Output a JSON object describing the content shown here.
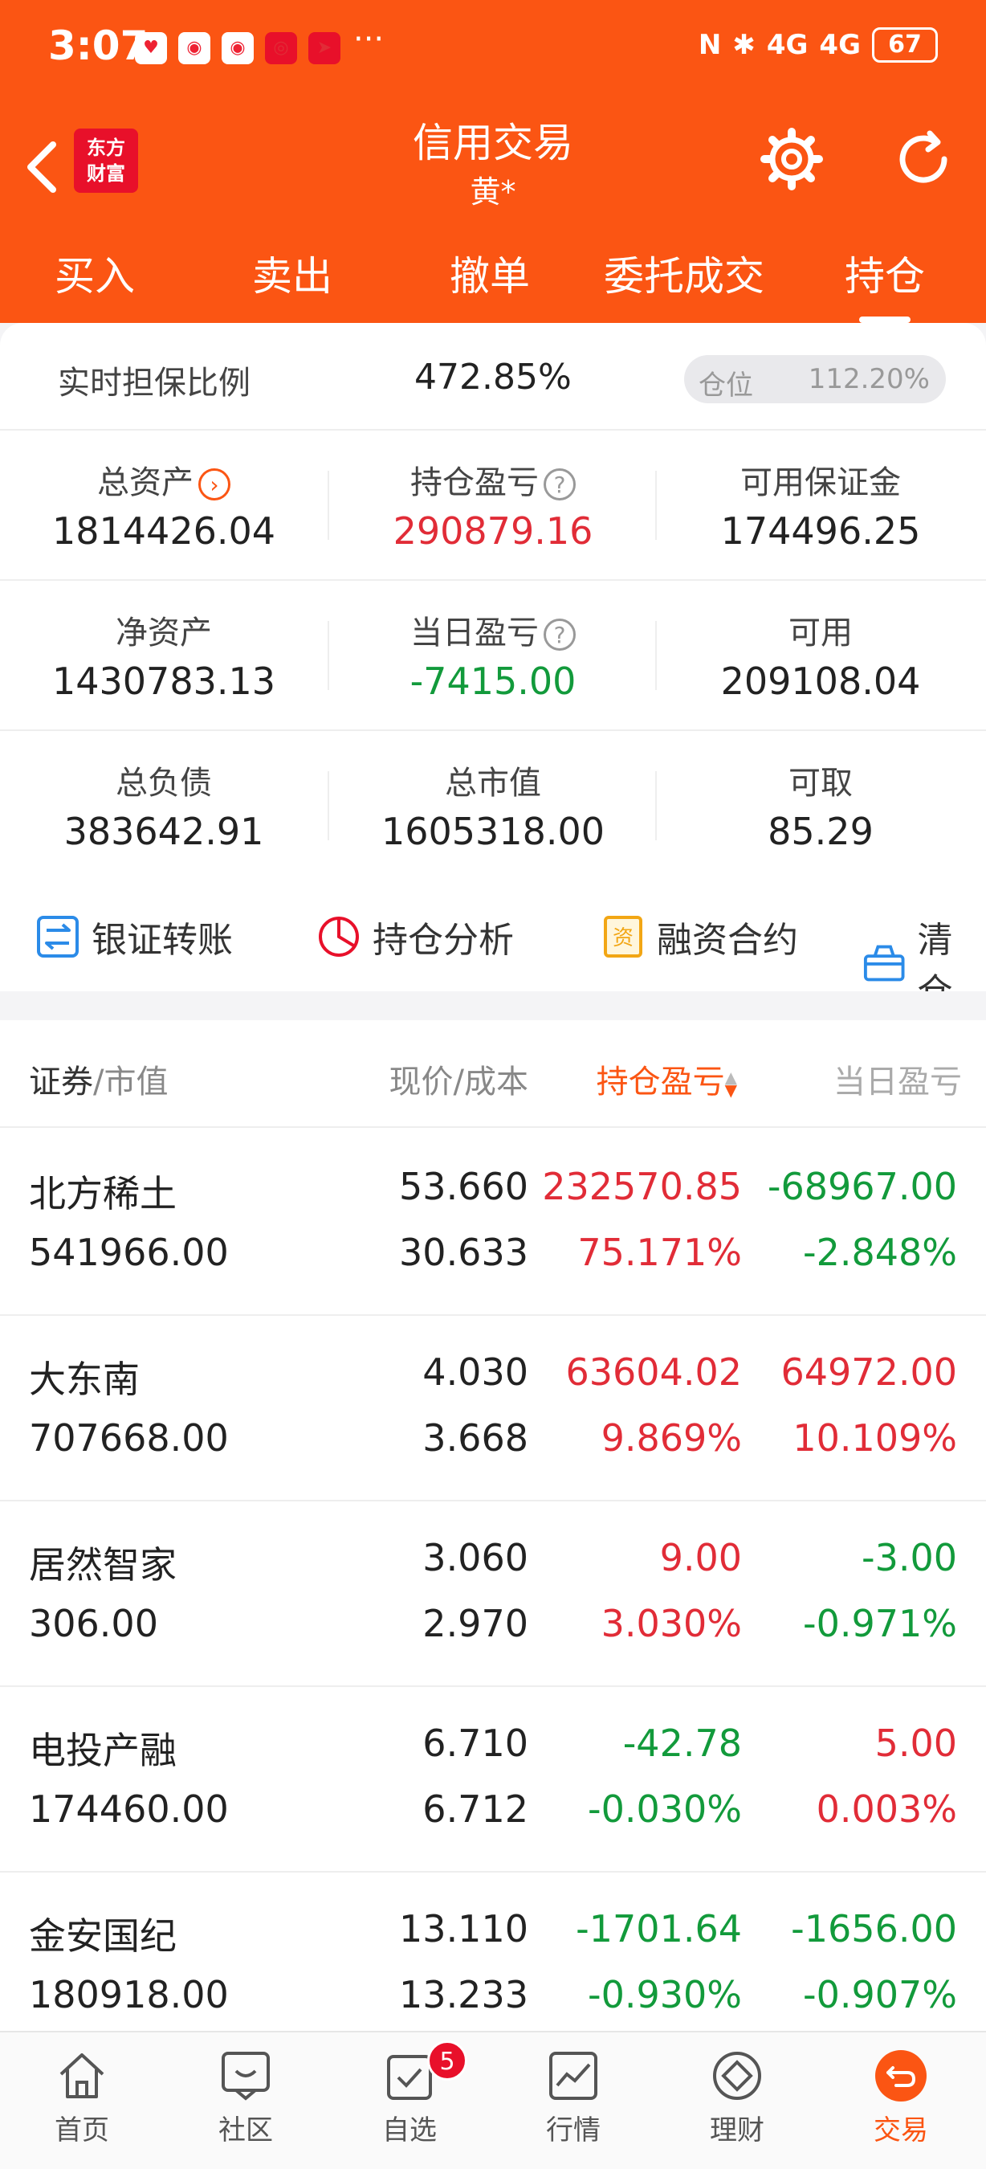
{
  "status": {
    "time": "3:07",
    "battery": "67",
    "more": "···",
    "signal_1": "4G",
    "signal_2": "4G"
  },
  "header": {
    "logo_line1": "东方",
    "logo_line2": "财富",
    "title": "信用交易",
    "subtitle": "黄*"
  },
  "tabs": [
    "买入",
    "卖出",
    "撤单",
    "委托成交",
    "持仓"
  ],
  "summary": {
    "ratio_label": "实时担保比例",
    "ratio_value": "472.85%",
    "position_label": "仓位",
    "position_value": "112.20%",
    "rows": [
      [
        {
          "label": "总资产",
          "value": "1814426.04"
        },
        {
          "label": "持仓盈亏",
          "value": "290879.16"
        },
        {
          "label": "可用保证金",
          "value": "174496.25"
        }
      ],
      [
        {
          "label": "净资产",
          "value": "1430783.13"
        },
        {
          "label": "当日盈亏",
          "value": "-7415.00"
        },
        {
          "label": "可用",
          "value": "209108.04"
        }
      ],
      [
        {
          "label": "总负债",
          "value": "383642.91"
        },
        {
          "label": "总市值",
          "value": "1605318.00"
        },
        {
          "label": "可取",
          "value": "85.29"
        }
      ]
    ]
  },
  "quick": [
    "银证转账",
    "持仓分析",
    "融资合约",
    "清仓"
  ],
  "holdings_header": {
    "col1": "证券",
    "col1_sub": "/市值",
    "col2": "现价/成本",
    "col3": "持仓盈亏",
    "col4": "当日盈亏"
  },
  "holdings": [
    {
      "name": "北方稀土",
      "mv": "541966.00",
      "price": "53.660",
      "cost": "30.633",
      "pl": "232570.85",
      "plp": "75.171%",
      "dp": "-68967.00",
      "dpp": "-2.848%"
    },
    {
      "name": "大东南",
      "mv": "707668.00",
      "price": "4.030",
      "cost": "3.668",
      "pl": "63604.02",
      "plp": "9.869%",
      "dp": "64972.00",
      "dpp": "10.109%"
    },
    {
      "name": "居然智家",
      "mv": "306.00",
      "price": "3.060",
      "cost": "2.970",
      "pl": "9.00",
      "plp": "3.030%",
      "dp": "-3.00",
      "dpp": "-0.971%"
    },
    {
      "name": "电投产融",
      "mv": "174460.00",
      "price": "6.710",
      "cost": "6.712",
      "pl": "-42.78",
      "plp": "-0.030%",
      "dp": "5.00",
      "dpp": "0.003%"
    },
    {
      "name": "金安国纪",
      "mv": "180918.00",
      "price": "13.110",
      "cost": "13.233",
      "pl": "-1701.64",
      "plp": "-0.930%",
      "dp": "-1656.00",
      "dpp": "-0.907%"
    }
  ],
  "bottom_nav": [
    "首页",
    "社区",
    "自选",
    "行情",
    "理财",
    "交易"
  ],
  "badge_count": "5",
  "colors": {
    "brand": "#fb5513",
    "up": "#e12c37",
    "down": "#129a3b"
  }
}
